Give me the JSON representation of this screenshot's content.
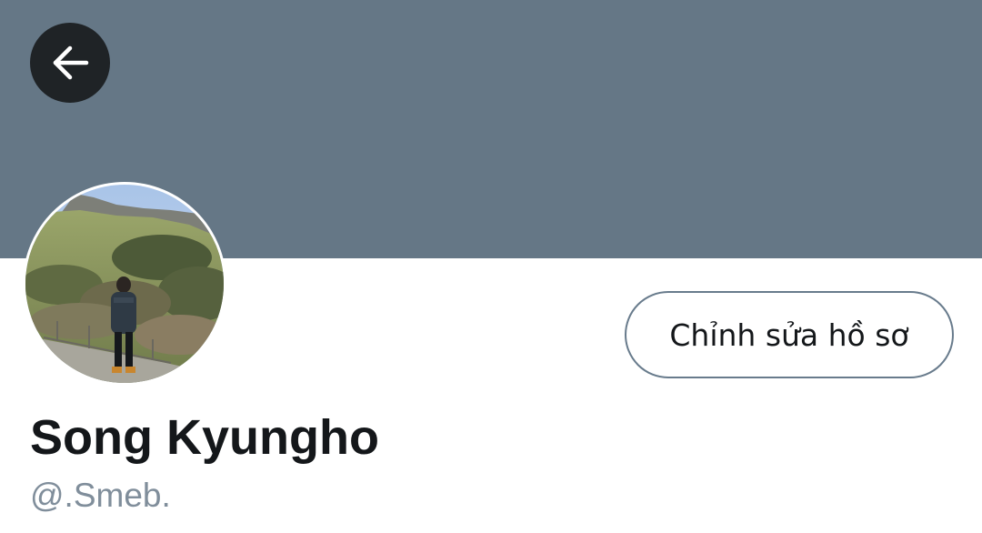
{
  "header": {
    "banner_color": "#657786",
    "back_icon": "arrow-left-icon"
  },
  "profile": {
    "avatar_icon": "profile-photo",
    "display_name": "Song Kyungho",
    "handle": "@.Smeb.",
    "edit_profile_label": "Chỉnh sửa hồ sơ"
  },
  "colors": {
    "background": "#ffffff",
    "back_button_bg": "#1f2326",
    "name_text": "#14171a",
    "handle_text": "#808e9b",
    "button_border": "#687b8c"
  }
}
